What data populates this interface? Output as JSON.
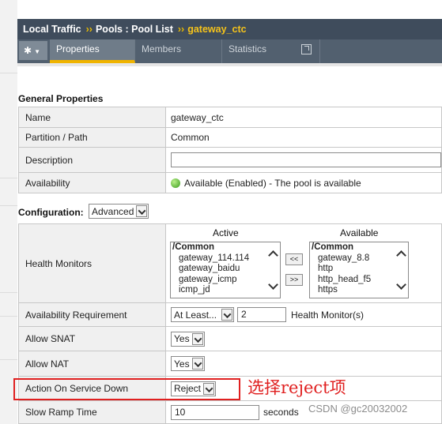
{
  "breadcrumb": {
    "item1": "Local Traffic",
    "sep1": "››",
    "item2": "Pools : Pool List",
    "sep2": "››",
    "current": "gateway_ctc"
  },
  "tabs": [
    {
      "label": "Properties",
      "active": true
    },
    {
      "label": "Members",
      "active": false
    },
    {
      "label": "Statistics",
      "active": false
    }
  ],
  "general": {
    "title": "General Properties",
    "name_label": "Name",
    "name_value": "gateway_ctc",
    "partition_label": "Partition / Path",
    "partition_value": "Common",
    "description_label": "Description",
    "description_value": "",
    "availability_label": "Availability",
    "availability_value": "Available (Enabled) - The pool is available"
  },
  "configuration": {
    "title": "Configuration:",
    "mode": "Advanced",
    "health_label": "Health Monitors",
    "active_header": "Active",
    "available_header": "Available",
    "active_group": "/Common",
    "active_items": [
      "gateway_114.114",
      "gateway_baidu",
      "gateway_icmp",
      "icmp_jd"
    ],
    "available_group": "/Common",
    "available_items": [
      "gateway_8.8",
      "http",
      "http_head_f5",
      "https"
    ],
    "move_left": "<<",
    "move_right": ">>",
    "avail_req_label": "Availability Requirement",
    "avail_req_mode": "At Least...",
    "avail_req_count": "2",
    "avail_req_suffix": "Health Monitor(s)",
    "snat_label": "Allow SNAT",
    "snat_value": "Yes",
    "nat_label": "Allow NAT",
    "nat_value": "Yes",
    "action_label": "Action On Service Down",
    "action_value": "Reject",
    "ramp_label": "Slow Ramp Time",
    "ramp_value": "10",
    "ramp_suffix": "seconds"
  },
  "annotation": "选择reject项",
  "watermark": "CSDN @gc20032002",
  "colors": {
    "header_bg": "#3f4c5c",
    "accent": "#f0b400",
    "annotation": "#e02020"
  }
}
